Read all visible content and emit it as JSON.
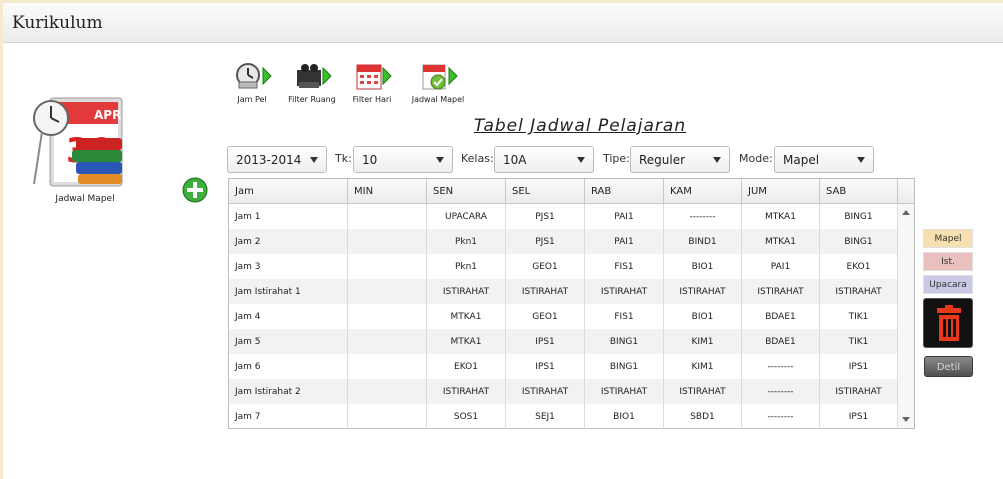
{
  "window": {
    "title": "Kurikulum"
  },
  "side": {
    "icon_label": "Jadwal Mapel"
  },
  "toolbar": [
    {
      "label": "Jam Pel"
    },
    {
      "label": "Filter Ruang"
    },
    {
      "label": "Filter Hari"
    },
    {
      "label": "Jadwal Mapel"
    }
  ],
  "heading": "Tabel Jadwal Pelajaran",
  "filters": {
    "year": "2013-2014",
    "tk_label": "Tk:",
    "tk_value": "10",
    "kelas_label": "Kelas:",
    "kelas_value": "10A",
    "tipe_label": "Tipe:",
    "tipe_value": "Reguler",
    "mode_label": "Mode:",
    "mode_value": "Mapel"
  },
  "table": {
    "columns": [
      "Jam",
      "MIN",
      "SEN",
      "SEL",
      "RAB",
      "KAM",
      "JUM",
      "SAB"
    ],
    "rows": [
      [
        "Jam 1",
        "",
        "UPACARA",
        "PJS1",
        "PAI1",
        "--------",
        "MTKA1",
        "BING1"
      ],
      [
        "Jam 2",
        "",
        "Pkn1",
        "PJS1",
        "PAI1",
        "BIND1",
        "MTKA1",
        "BING1"
      ],
      [
        "Jam 3",
        "",
        "Pkn1",
        "GEO1",
        "FIS1",
        "BIO1",
        "PAI1",
        "EKO1"
      ],
      [
        "Jam Istirahat 1",
        "",
        "ISTIRAHAT",
        "ISTIRAHAT",
        "ISTIRAHAT",
        "ISTIRAHAT",
        "ISTIRAHAT",
        "ISTIRAHAT"
      ],
      [
        "Jam 4",
        "",
        "MTKA1",
        "GEO1",
        "FIS1",
        "BIO1",
        "BDAE1",
        "TIK1"
      ],
      [
        "Jam 5",
        "",
        "MTKA1",
        "IPS1",
        "BING1",
        "KIM1",
        "BDAE1",
        "TIK1"
      ],
      [
        "Jam 6",
        "",
        "EKO1",
        "IPS1",
        "BING1",
        "KIM1",
        "--------",
        "IPS1"
      ],
      [
        "Jam Istirahat 2",
        "",
        "ISTIRAHAT",
        "ISTIRAHAT",
        "ISTIRAHAT",
        "ISTIRAHAT",
        "--------",
        "ISTIRAHAT"
      ],
      [
        "Jam 7",
        "",
        "SOS1",
        "SEJ1",
        "BIO1",
        "SBD1",
        "--------",
        "IPS1"
      ]
    ]
  },
  "legend": [
    {
      "label": "Mapel",
      "color": "#f6dfb0"
    },
    {
      "label": "Ist.",
      "color": "#e9c0bd"
    },
    {
      "label": "Upacara",
      "color": "#c9c9e6"
    }
  ],
  "buttons": {
    "detil": "Detil"
  }
}
